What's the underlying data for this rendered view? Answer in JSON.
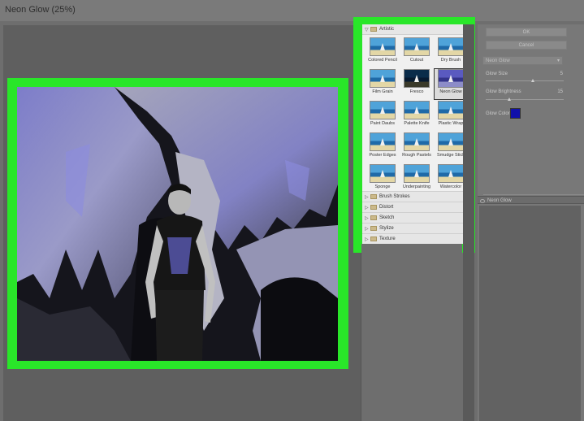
{
  "window": {
    "title": "Neon Glow (25%)"
  },
  "gallery": {
    "open_folder": "Artistic",
    "filters": [
      {
        "label": "Colored Pencil",
        "style": "normal"
      },
      {
        "label": "Cutout",
        "style": "normal"
      },
      {
        "label": "Dry Brush",
        "style": "normal"
      },
      {
        "label": "Film Grain",
        "style": "normal"
      },
      {
        "label": "Fresco",
        "style": "dark"
      },
      {
        "label": "Neon Glow",
        "style": "neon",
        "selected": true
      },
      {
        "label": "Paint Daubs",
        "style": "normal"
      },
      {
        "label": "Palette Knife",
        "style": "normal"
      },
      {
        "label": "Plastic Wrap",
        "style": "normal"
      },
      {
        "label": "Poster Edges",
        "style": "normal"
      },
      {
        "label": "Rough Pastels",
        "style": "normal"
      },
      {
        "label": "Smudge Stick",
        "style": "normal"
      },
      {
        "label": "Sponge",
        "style": "normal"
      },
      {
        "label": "Underpainting",
        "style": "normal"
      },
      {
        "label": "Watercolor",
        "style": "normal"
      }
    ],
    "folders": [
      "Brush Strokes",
      "Distort",
      "Sketch",
      "Stylize",
      "Texture"
    ]
  },
  "dialog": {
    "ok_label": "OK",
    "cancel_label": "Cancel",
    "filter_select": "Neon Glow",
    "glow_size_label": "Glow Size",
    "glow_size_value": "5",
    "glow_size_fraction": 0.6,
    "glow_brightness_label": "Glow Brightness",
    "glow_brightness_value": "15",
    "glow_brightness_fraction": 0.3,
    "glow_color_label": "Glow Color",
    "glow_color_hex": "#1010aa"
  },
  "layers": {
    "layer_name": "Neon Glow"
  },
  "colors": {
    "highlight": "#29e629",
    "neon_tint": "#8a8ad8"
  }
}
